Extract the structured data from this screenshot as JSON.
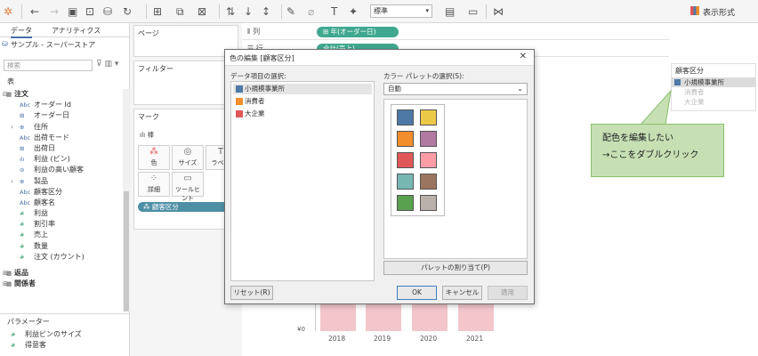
{
  "toolbar": {
    "format_select": "標準",
    "show_me_label": "表示形式"
  },
  "data_pane": {
    "tabs": [
      "データ",
      "アナリティクス"
    ],
    "datasource": "サンプル - スーパーストア",
    "search_placeholder": "検索",
    "section_label": "表",
    "fields": [
      {
        "type": "header",
        "icon": "table-icon",
        "name": "注文",
        "expand": "⊟"
      },
      {
        "type": "dim",
        "icon": "Abc",
        "name": "オーダー Id"
      },
      {
        "type": "dim",
        "icon": "⊞",
        "name": "オーダー日"
      },
      {
        "type": "dim",
        "icon": "⊕",
        "name": "住所",
        "expand": "›"
      },
      {
        "type": "dim",
        "icon": "Abc",
        "name": "出荷モード"
      },
      {
        "type": "dim",
        "icon": "⊞",
        "name": "出荷日"
      },
      {
        "type": "dim",
        "icon": "ılı",
        "name": "利益 (ビン)"
      },
      {
        "type": "dim",
        "icon": "⊘",
        "name": "利益の高い顧客"
      },
      {
        "type": "dim",
        "icon": "⊕",
        "name": "製品",
        "expand": "›"
      },
      {
        "type": "dim",
        "icon": "Abc",
        "name": "顧客区分"
      },
      {
        "type": "dim",
        "icon": "Abc",
        "name": "顧客名"
      },
      {
        "type": "meas",
        "icon": "#",
        "name": "利益"
      },
      {
        "type": "meas",
        "icon": "#",
        "name": "割引率"
      },
      {
        "type": "meas",
        "icon": "#",
        "name": "売上"
      },
      {
        "type": "meas",
        "icon": "#",
        "name": "数量"
      },
      {
        "type": "meas",
        "icon": "#",
        "name": "注文 (カウント)"
      },
      {
        "type": "spacer",
        "name": ""
      },
      {
        "type": "header",
        "icon": "table-icon",
        "name": "返品",
        "expand": "⊞"
      },
      {
        "type": "header",
        "icon": "table-icon",
        "name": "関係者",
        "expand": "⊞"
      }
    ],
    "parameters_title": "パラメーター",
    "parameters": [
      "利益ビンのサイズ",
      "得意客"
    ]
  },
  "shelves": {
    "pages": "ページ",
    "filters": "フィルター",
    "marks": "マーク",
    "mark_type": "棒",
    "mark_buttons": [
      {
        "icon": "color-icon",
        "glyph": "⁂",
        "label": "色"
      },
      {
        "icon": "size-icon",
        "glyph": "◎",
        "label": "サイズ"
      },
      {
        "icon": "label-icon",
        "glyph": "T",
        "label": "ラベル"
      },
      {
        "icon": "detail-icon",
        "glyph": "⁘",
        "label": "詳細"
      },
      {
        "icon": "tooltip-icon",
        "glyph": "▭",
        "label": "ツールヒント"
      }
    ],
    "color_pill": "顧客区分",
    "columns_label": "列",
    "columns_pill": "年(オーダー日)",
    "rows_label": "行",
    "rows_pill": "合計(売上)"
  },
  "viz": {
    "y_tick": "¥0",
    "years": [
      "2018",
      "2019",
      "2020",
      "2021"
    ],
    "bar_color": "#f3c6cc"
  },
  "legend": {
    "title": "顧客区分",
    "items": [
      {
        "name": "小規模事業所",
        "color": "#4e79a7"
      },
      {
        "name": "消費者",
        "color": "#f28e2b"
      },
      {
        "name": "大企業",
        "color": "#e15759"
      }
    ]
  },
  "callout": {
    "line1": "配色を編集したい",
    "line2": "→ここをダブルクリック"
  },
  "dialog": {
    "title": "色の編集 [顧客区分]",
    "items_label": "データ項目の選択:",
    "items": [
      {
        "name": "小規模事業所",
        "color": "#4e79a7"
      },
      {
        "name": "消費者",
        "color": "#f28e2b"
      },
      {
        "name": "大企業",
        "color": "#e15759"
      }
    ],
    "palette_label": "カラー パレットの選択(S):",
    "palette_value": "自動",
    "swatches": [
      "#4e79a7",
      "#edc948",
      "#f28e2b",
      "#b07aa1",
      "#e15759",
      "#ff9da7",
      "#76b7b2",
      "#9c755f",
      "#59a14f",
      "#bab0ac"
    ],
    "assign_button": "パレットの割り当て(P)",
    "reset_button": "リセット(R)",
    "ok_button": "OK",
    "cancel_button": "キャンセル",
    "apply_button": "適用"
  }
}
